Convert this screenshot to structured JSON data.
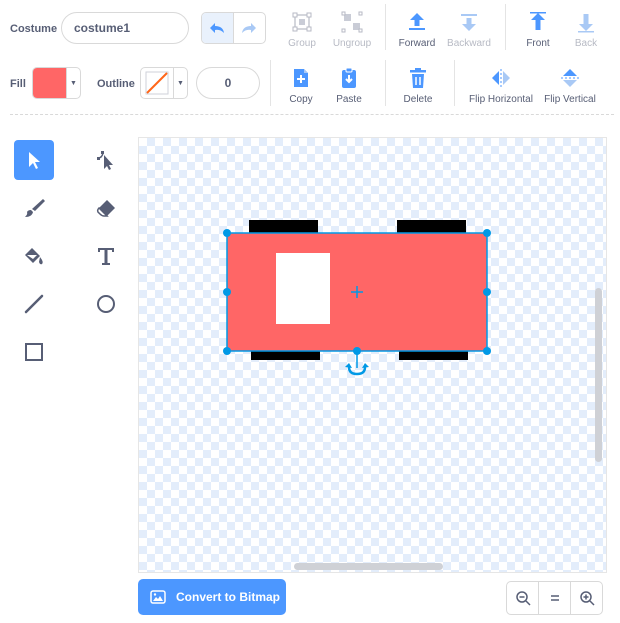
{
  "costume": {
    "label": "Costume",
    "name": "costume1"
  },
  "toolbar": {
    "group": "Group",
    "ungroup": "Ungroup",
    "forward": "Forward",
    "backward": "Backward",
    "front": "Front",
    "back": "Back",
    "copy": "Copy",
    "paste": "Paste",
    "delete": "Delete",
    "flip_horizontal": "Flip Horizontal",
    "flip_vertical": "Flip Vertical"
  },
  "fill": {
    "label": "Fill",
    "color": "#FF6666"
  },
  "outline": {
    "label": "Outline",
    "width": "0",
    "color": "none"
  },
  "tools": [
    "select-icon",
    "reshape-icon",
    "brush-icon",
    "eraser-icon",
    "fill-icon",
    "text-icon",
    "line-icon",
    "circle-icon",
    "rectangle-icon"
  ],
  "canvas": {
    "body_color": "#FF6666",
    "wheel_color": "#000000",
    "window_color": "#FFFFFF",
    "selection_color": "#0099E6"
  },
  "footer": {
    "convert_label": "Convert to Bitmap",
    "zoom_out_icon": "zoom-out-icon",
    "zoom_reset_icon": "zoom-reset-icon",
    "zoom_in_icon": "zoom-in-icon"
  },
  "colors": {
    "accent": "#4C97FF",
    "text": "#575E75",
    "disabled": "#B7BAC4"
  }
}
